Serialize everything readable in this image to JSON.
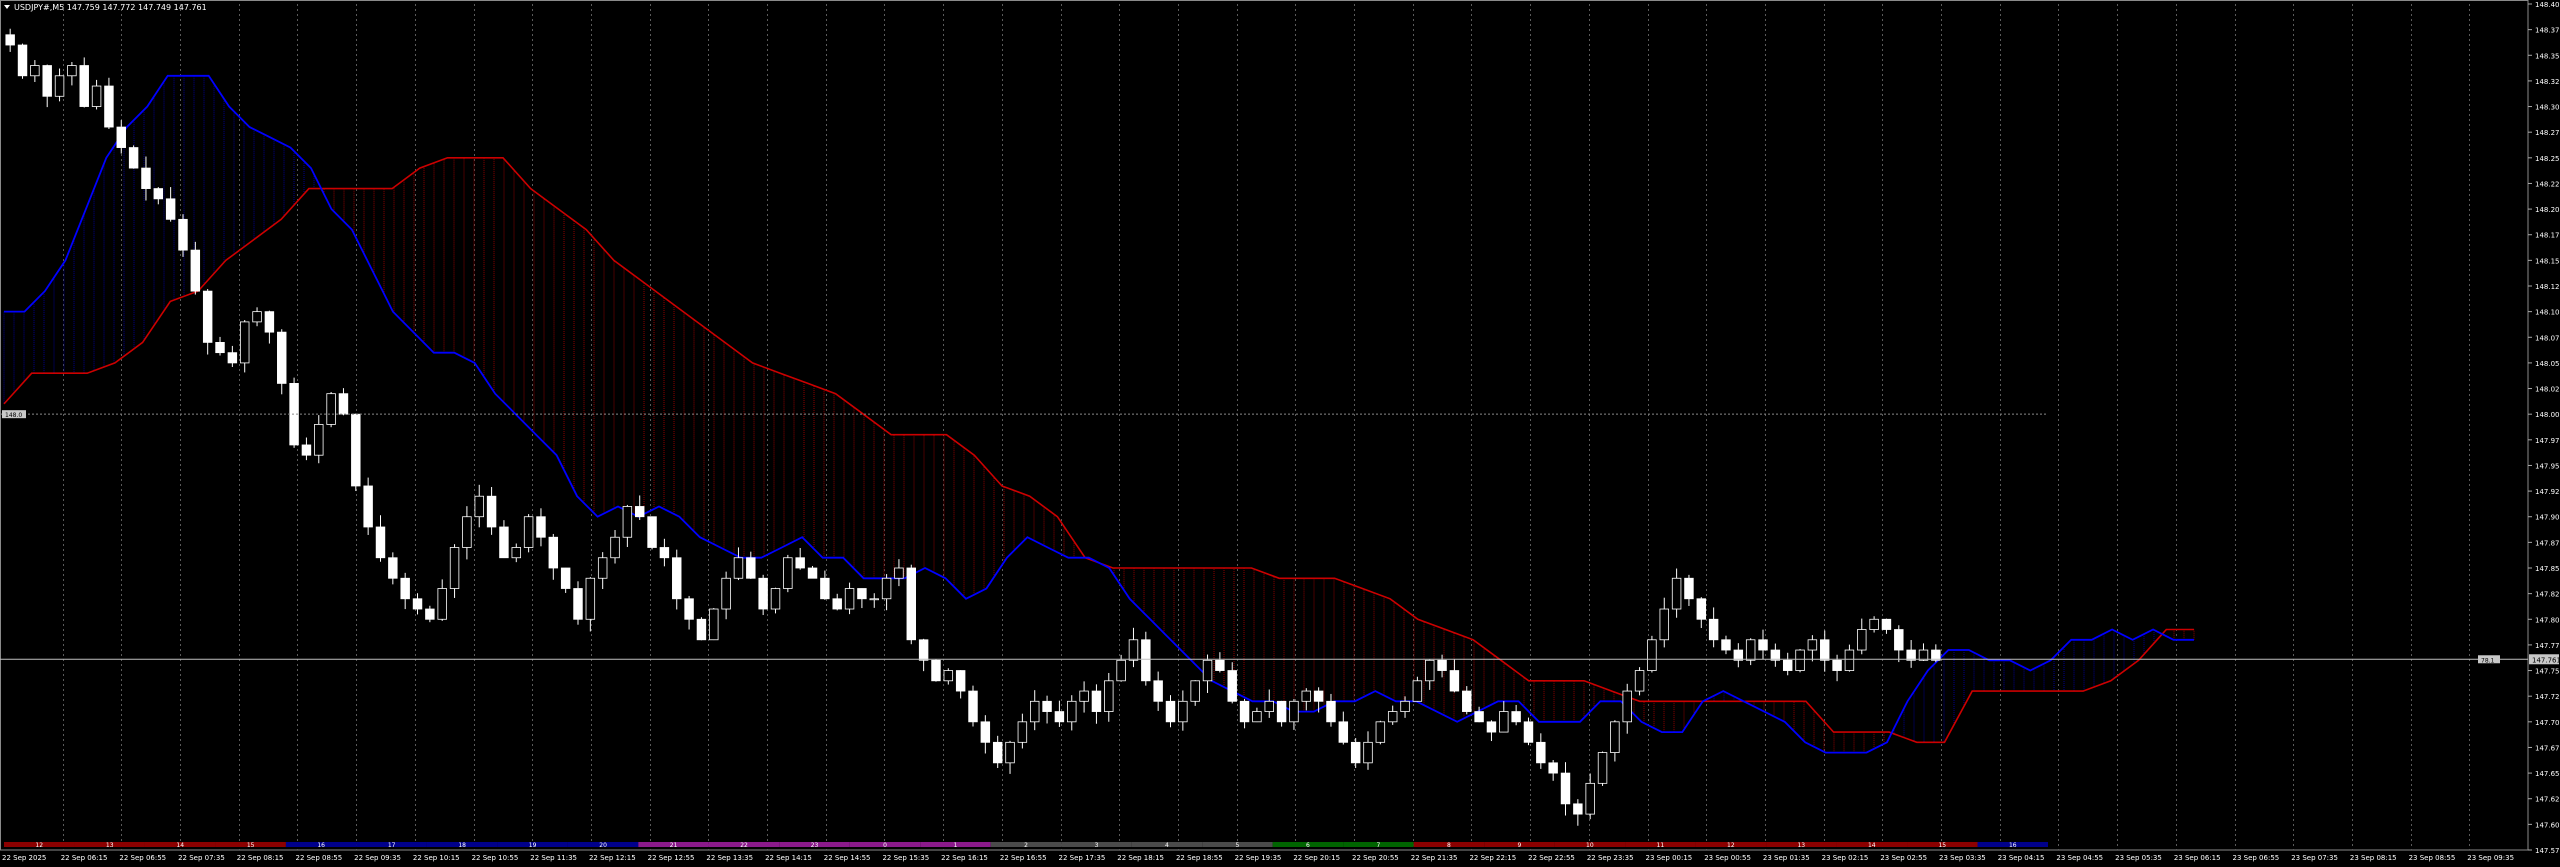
{
  "header": {
    "symbol_line": "USDJPY#,M5  147.759 147.772 147.749 147.761"
  },
  "colors": {
    "background": "#000000",
    "candle_up": "#ffffff",
    "candle_down": "#ffffff",
    "kijun": "#0000ff",
    "span_a": "#0000d0",
    "span_b": "#cc0000",
    "kumo_bull": "#00008b",
    "kumo_bear": "#8b0000",
    "grid": "#5a5a5a",
    "bid_line": "#c0c0c0"
  },
  "chart_data": {
    "type": "candlestick",
    "symbol": "USDJPY#",
    "timeframe": "M5",
    "ohlc_readout": [
      147.759,
      147.772,
      147.749,
      147.761
    ],
    "ylim": [
      147.575,
      148.4
    ],
    "price_ticks": [
      "148.400",
      "148.375",
      "148.350",
      "148.325",
      "148.300",
      "148.275",
      "148.250",
      "148.225",
      "148.200",
      "148.175",
      "148.150",
      "148.125",
      "148.100",
      "148.075",
      "148.050",
      "148.025",
      "148.000",
      "147.975",
      "147.950",
      "147.925",
      "147.900",
      "147.875",
      "147.850",
      "147.825",
      "147.800",
      "147.775",
      "147.750",
      "147.725",
      "147.700",
      "147.675",
      "147.650",
      "147.625",
      "147.600",
      "147.575"
    ],
    "current_price_label": "147.761",
    "current_price": 147.761,
    "left_marker_label": "148.0",
    "left_marker_price": 148.0,
    "right_tag_label": "78.1",
    "time_labels": [
      "22 Sep 2025",
      "22 Sep 06:15",
      "22 Sep 06:55",
      "22 Sep 07:35",
      "22 Sep 08:15",
      "22 Sep 08:55",
      "22 Sep 09:35",
      "22 Sep 10:15",
      "22 Sep 10:55",
      "22 Sep 11:35",
      "22 Sep 12:15",
      "22 Sep 12:55",
      "22 Sep 13:35",
      "22 Sep 14:15",
      "22 Sep 14:55",
      "22 Sep 15:35",
      "22 Sep 16:15",
      "22 Sep 16:55",
      "22 Sep 17:35",
      "22 Sep 18:15",
      "22 Sep 18:55",
      "22 Sep 19:35",
      "22 Sep 20:15",
      "22 Sep 20:55",
      "22 Sep 21:35",
      "22 Sep 22:15",
      "22 Sep 22:55",
      "22 Sep 23:35",
      "23 Sep 00:15",
      "23 Sep 00:55",
      "23 Sep 01:35",
      "23 Sep 02:15",
      "23 Sep 02:55",
      "23 Sep 03:35",
      "23 Sep 04:15",
      "23 Sep 04:55",
      "23 Sep 05:35",
      "23 Sep 06:15",
      "23 Sep 06:55",
      "23 Sep 07:35",
      "23 Sep 08:15",
      "23 Sep 08:55",
      "23 Sep 09:35"
    ],
    "session_bands": [
      {
        "label": "12",
        "color": "#8b0000"
      },
      {
        "label": "13",
        "color": "#8b0000"
      },
      {
        "label": "14",
        "color": "#8b0000"
      },
      {
        "label": "15",
        "color": "#8b0000"
      },
      {
        "label": "16",
        "color": "#00008b"
      },
      {
        "label": "17",
        "color": "#00008b"
      },
      {
        "label": "18",
        "color": "#00008b"
      },
      {
        "label": "19",
        "color": "#00008b"
      },
      {
        "label": "20",
        "color": "#00008b"
      },
      {
        "label": "21",
        "color": "#8b1a8b"
      },
      {
        "label": "22",
        "color": "#8b1a8b"
      },
      {
        "label": "23",
        "color": "#8b1a8b"
      },
      {
        "label": "0",
        "color": "#8b1a8b"
      },
      {
        "label": "1",
        "color": "#8b1a8b"
      },
      {
        "label": "2",
        "color": "#4a4a4a"
      },
      {
        "label": "3",
        "color": "#4a4a4a"
      },
      {
        "label": "4",
        "color": "#4a4a4a"
      },
      {
        "label": "5",
        "color": "#4a4a4a"
      },
      {
        "label": "6",
        "color": "#006400"
      },
      {
        "label": "7",
        "color": "#006400"
      },
      {
        "label": "8",
        "color": "#8b0000"
      },
      {
        "label": "9",
        "color": "#8b0000"
      },
      {
        "label": "10",
        "color": "#8b0000"
      },
      {
        "label": "11",
        "color": "#8b0000"
      },
      {
        "label": "12",
        "color": "#8b0000"
      },
      {
        "label": "13",
        "color": "#8b0000"
      },
      {
        "label": "14",
        "color": "#8b0000"
      },
      {
        "label": "15",
        "color": "#8b0000"
      },
      {
        "label": "16",
        "color": "#00008b"
      }
    ],
    "close_path": [
      148.36,
      148.33,
      148.34,
      148.31,
      148.33,
      148.34,
      148.3,
      148.32,
      148.28,
      148.26,
      148.24,
      148.22,
      148.21,
      148.19,
      148.16,
      148.12,
      148.07,
      148.06,
      148.05,
      148.09,
      148.1,
      148.08,
      148.03,
      147.97,
      147.96,
      147.99,
      148.02,
      148.0,
      147.93,
      147.89,
      147.86,
      147.84,
      147.82,
      147.81,
      147.8,
      147.83,
      147.87,
      147.9,
      147.92,
      147.89,
      147.86,
      147.87,
      147.9,
      147.88,
      147.85,
      147.83,
      147.8,
      147.84,
      147.86,
      147.88,
      147.91,
      147.9,
      147.87,
      147.86,
      147.82,
      147.8,
      147.78,
      147.81,
      147.84,
      147.86,
      147.84,
      147.81,
      147.83,
      147.86,
      147.85,
      147.84,
      147.82,
      147.81,
      147.83,
      147.82,
      147.82,
      147.84,
      147.85,
      147.78,
      147.76,
      147.74,
      147.75,
      147.73,
      147.7,
      147.68,
      147.66,
      147.68,
      147.7,
      147.72,
      147.71,
      147.7,
      147.72,
      147.73,
      147.71,
      147.74,
      147.76,
      147.78,
      147.74,
      147.72,
      147.7,
      147.72,
      147.74,
      147.76,
      147.75,
      147.72,
      147.7,
      147.71,
      147.72,
      147.7,
      147.72,
      147.73,
      147.72,
      147.7,
      147.68,
      147.66,
      147.68,
      147.7,
      147.71,
      147.72,
      147.74,
      147.76,
      147.75,
      147.73,
      147.71,
      147.7,
      147.69,
      147.71,
      147.7,
      147.68,
      147.66,
      147.65,
      147.62,
      147.61,
      147.64,
      147.67,
      147.7,
      147.73,
      147.75,
      147.78,
      147.81,
      147.84,
      147.82,
      147.8,
      147.78,
      147.77,
      147.76,
      147.78,
      147.77,
      147.76,
      147.75,
      147.77,
      147.78,
      147.76,
      147.75,
      147.77,
      147.79,
      147.8,
      147.79,
      147.77,
      147.76,
      147.77,
      147.76
    ],
    "kijun_path": [
      148.1,
      148.1,
      148.12,
      148.15,
      148.2,
      148.25,
      148.28,
      148.3,
      148.33,
      148.33,
      148.33,
      148.3,
      148.28,
      148.27,
      148.26,
      148.24,
      148.2,
      148.18,
      148.14,
      148.1,
      148.08,
      148.06,
      148.06,
      148.05,
      148.02,
      148.0,
      147.98,
      147.96,
      147.92,
      147.9,
      147.91,
      147.9,
      147.91,
      147.9,
      147.88,
      147.87,
      147.86,
      147.86,
      147.87,
      147.88,
      147.86,
      147.86,
      147.84,
      147.84,
      147.84,
      147.85,
      147.84,
      147.82,
      147.83,
      147.86,
      147.88,
      147.87,
      147.86,
      147.86,
      147.85,
      147.82,
      147.8,
      147.78,
      147.76,
      147.74,
      147.73,
      147.72,
      147.72,
      147.71,
      147.71,
      147.72,
      147.72,
      147.73,
      147.72,
      147.72,
      147.71,
      147.7,
      147.71,
      147.72,
      147.72,
      147.7,
      147.7,
      147.7,
      147.72,
      147.72,
      147.7,
      147.69,
      147.69,
      147.72,
      147.73,
      147.72,
      147.71,
      147.7,
      147.68,
      147.67,
      147.67,
      147.67,
      147.68,
      147.72,
      147.75,
      147.77,
      147.77,
      147.76,
      147.76,
      147.75,
      147.76,
      147.78,
      147.78,
      147.79,
      147.78,
      147.79,
      147.78,
      147.78
    ],
    "span_b_path": [
      148.01,
      148.04,
      148.04,
      148.04,
      148.05,
      148.07,
      148.11,
      148.12,
      148.15,
      148.17,
      148.19,
      148.22,
      148.22,
      148.22,
      148.22,
      148.24,
      148.25,
      148.25,
      148.25,
      148.22,
      148.2,
      148.18,
      148.15,
      148.13,
      148.11,
      148.09,
      148.07,
      148.05,
      148.04,
      148.03,
      148.02,
      148.0,
      147.98,
      147.98,
      147.98,
      147.96,
      147.93,
      147.92,
      147.9,
      147.86,
      147.85,
      147.85,
      147.85,
      147.85,
      147.85,
      147.85,
      147.84,
      147.84,
      147.84,
      147.83,
      147.82,
      147.8,
      147.79,
      147.78,
      147.76,
      147.74,
      147.74,
      147.74,
      147.73,
      147.72,
      147.72,
      147.72,
      147.72,
      147.72,
      147.72,
      147.72,
      147.69,
      147.69,
      147.69,
      147.68,
      147.68,
      147.73,
      147.73,
      147.73,
      147.73,
      147.73,
      147.74,
      147.76,
      147.79,
      147.79
    ]
  }
}
